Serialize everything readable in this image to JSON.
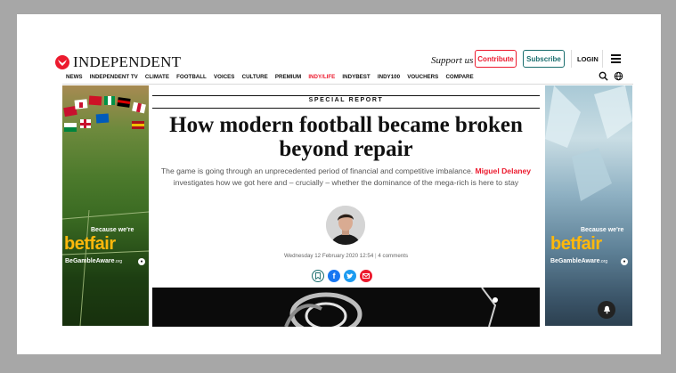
{
  "header": {
    "logo_text": "INDEPENDENT",
    "support_label": "Support us",
    "contribute_label": "Contribute",
    "subscribe_label": "Subscribe",
    "login_label": "LOGIN"
  },
  "nav": {
    "items": [
      "NEWS",
      "INDEPENDENT TV",
      "CLIMATE",
      "FOOTBALL",
      "VOICES",
      "CULTURE",
      "PREMIUM",
      "INDY/LIFE",
      "INDYBEST",
      "INDY100",
      "VOUCHERS",
      "COMPARE"
    ],
    "highlighted": "INDY/LIFE"
  },
  "article": {
    "kicker": "SPECIAL REPORT",
    "title": "How modern football became broken beyond repair",
    "standfirst_before": "The game is going through an unprecedented period of financial and competitive imbalance. ",
    "author": "Miguel Delaney",
    "standfirst_after": " investigates how we got here and – crucially – whether the dominance of the mega-rich is here to stay",
    "date": "Wednesday 12 February 2020 12:54",
    "comments": "4 comments"
  },
  "ads": {
    "left": {
      "because": "Because we're",
      "brand": "betfair",
      "gamble": "BeGambleAware",
      "gamble_suffix": ".org"
    },
    "right": {
      "because": "Because we're",
      "brand": "betfair",
      "gamble": "BeGambleAware",
      "gamble_suffix": ".org"
    }
  },
  "colors": {
    "brand_red": "#ec1a2e",
    "subscribe_teal": "#1a6e6e",
    "betfair_yellow": "#ffb80c"
  }
}
